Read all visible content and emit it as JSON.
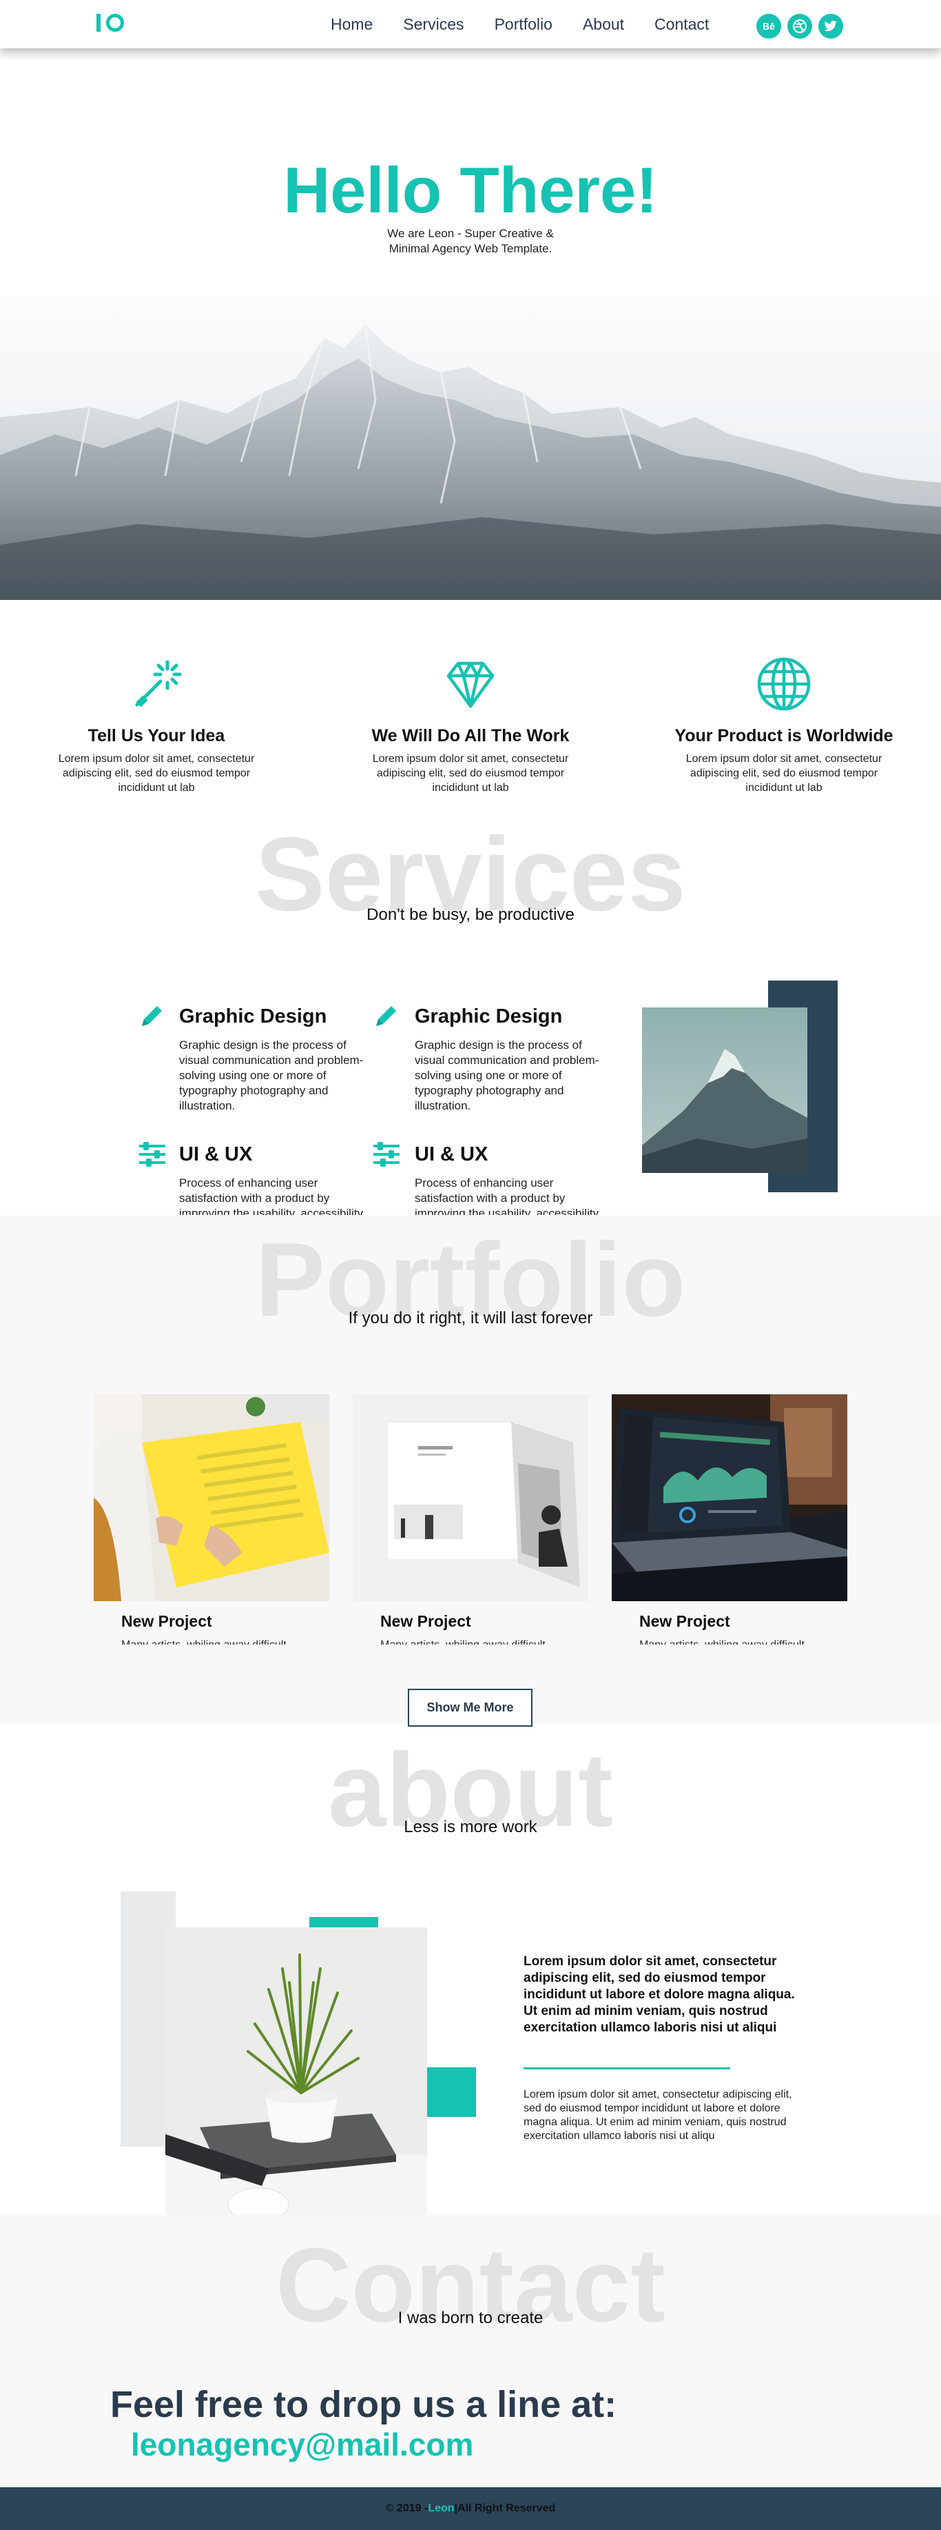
{
  "nav": {
    "links": [
      "Home",
      "Services",
      "Portfolio",
      "About",
      "Contact"
    ],
    "social": [
      {
        "label": "Bē",
        "icon": "behance-icon"
      },
      {
        "label": "",
        "icon": "dribbble-icon"
      },
      {
        "label": "",
        "icon": "twitter-icon"
      }
    ]
  },
  "hero": {
    "title": "Hello There!",
    "subtitle": "We are Leon - Super Creative & Minimal Agency Web Template."
  },
  "features": [
    {
      "icon": "magic-wand-icon",
      "title": "Tell Us Your Idea",
      "text": "Lorem ipsum dolor sit amet, consectetur adipiscing elit, sed do eiusmod tempor incididunt ut lab"
    },
    {
      "icon": "diamond-icon",
      "title": "We Will Do All The Work",
      "text": "Lorem ipsum dolor sit amet, consectetur adipiscing elit, sed do eiusmod tempor incididunt ut lab"
    },
    {
      "icon": "globe-icon",
      "title": "Your Product is Worldwide",
      "text": "Lorem ipsum dolor sit amet, consectetur adipiscing elit, sed do eiusmod tempor incididunt ut lab"
    }
  ],
  "services": {
    "title": "Services",
    "subtitle": "Don't be busy, be productive",
    "items": [
      {
        "icon": "pencil-icon",
        "title": "Graphic Design",
        "text": "Graphic design is the process of visual communication and problem-solving using one or more of typography photography and illustration."
      },
      {
        "icon": "pencil-icon",
        "title": "Graphic Design",
        "text": "Graphic design is the process of visual communication and problem-solving using one or more of typography photography and illustration."
      },
      {
        "icon": "sliders-icon",
        "title": "UI & UX",
        "text": "Process of enhancing user satisfaction with a product by improving the usability, accessibility, and pleasure provided in the interaction."
      },
      {
        "icon": "sliders-icon",
        "title": "UI & UX",
        "text": "Process of enhancing user satisfaction with a product by improving the usability, accessibility, and pleasure provided in the interaction."
      }
    ]
  },
  "portfolio": {
    "title": "Portfolio",
    "subtitle": "If you do it right, it will last forever",
    "projects": [
      {
        "title": "New Project",
        "text": "Many artists, whiling away difficult"
      },
      {
        "title": "New Project",
        "text": "Many artists, whiling away difficult"
      },
      {
        "title": "New Project",
        "text": "Many artists, whiling away difficult"
      }
    ],
    "button": "Show Me More"
  },
  "about": {
    "title": "about",
    "subtitle": "Less is more work",
    "bold_text": "Lorem ipsum dolor sit amet, consectetur adipiscing elit, sed do eiusmod tempor incididunt ut labore et dolore magna aliqua. Ut enim ad minim veniam, quis nostrud exercitation ullamco laboris nisi ut aliqui",
    "text": "Lorem ipsum dolor sit amet, consectetur adipiscing elit, sed do eiusmod tempor incididunt ut labore et dolore magna aliqua. Ut enim ad minim veniam, quis nostrud exercitation ullamco laboris nisi ut aliqu"
  },
  "contact": {
    "title": "Contact",
    "subtitle": "I was born to create",
    "heading": "Feel free to drop us a line at:",
    "email": "leonagency@mail.com"
  },
  "footer": {
    "prefix": "© 2019 - ",
    "brand": "Leon",
    "suffix": "|All Right Reserved"
  },
  "colors": {
    "accent": "#16c2b2",
    "dark": "#2a4558"
  }
}
